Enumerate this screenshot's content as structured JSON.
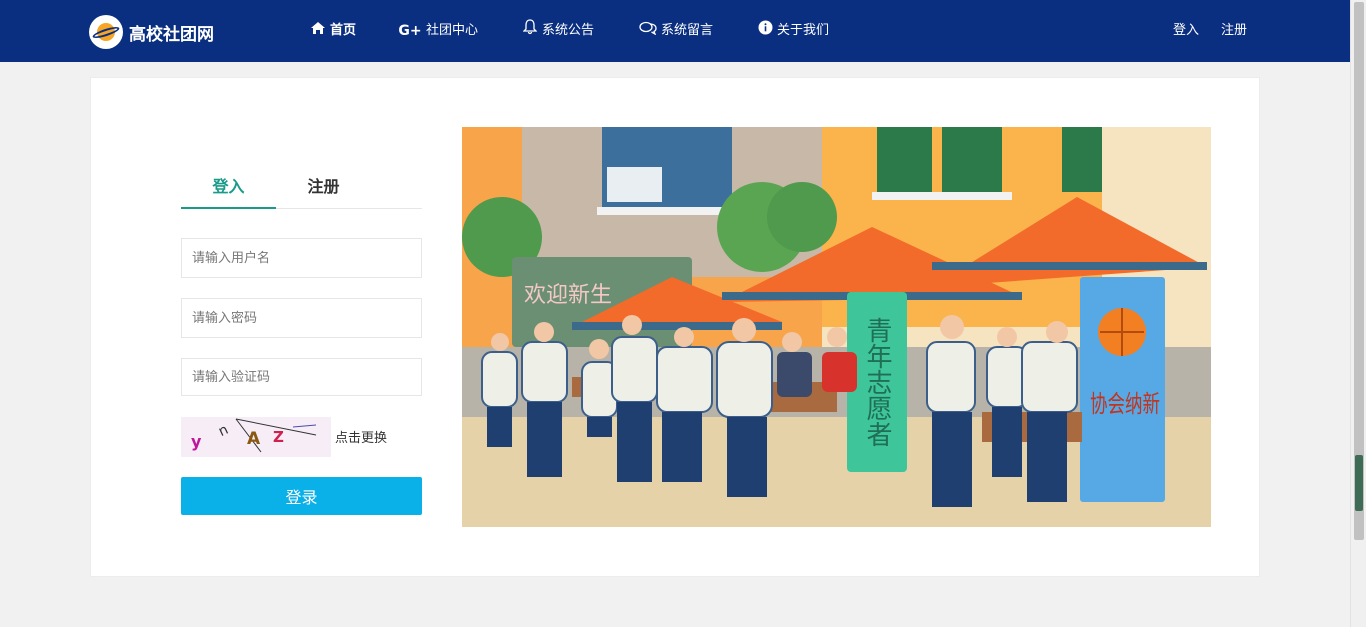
{
  "navbar": {
    "brand": "高校社团网",
    "items": [
      {
        "label": "首页",
        "icon": "home-icon"
      },
      {
        "label": "社团中心",
        "icon": "google-plus-icon"
      },
      {
        "label": "系统公告",
        "icon": "bell-icon"
      },
      {
        "label": "系统留言",
        "icon": "comments-icon"
      },
      {
        "label": "关于我们",
        "icon": "info-icon"
      }
    ],
    "login": "登入",
    "register": "注册"
  },
  "login_form": {
    "tabs": [
      "登入",
      "注册"
    ],
    "username_placeholder": "请输入用户名",
    "password_placeholder": "请输入密码",
    "captcha_placeholder": "请输入验证码",
    "captcha_chars": [
      "y",
      "n",
      "A",
      "Z"
    ],
    "captcha_refresh": "点击更换",
    "submit": "登录"
  },
  "banner": {
    "sign_left": "欢迎新生",
    "banner_green": "青年志愿者",
    "banner_blue": "协会纳新"
  },
  "colors": {
    "nav_bg": "#0b2f80",
    "accent": "#1a9b8a",
    "button": "#0ab0e8"
  }
}
